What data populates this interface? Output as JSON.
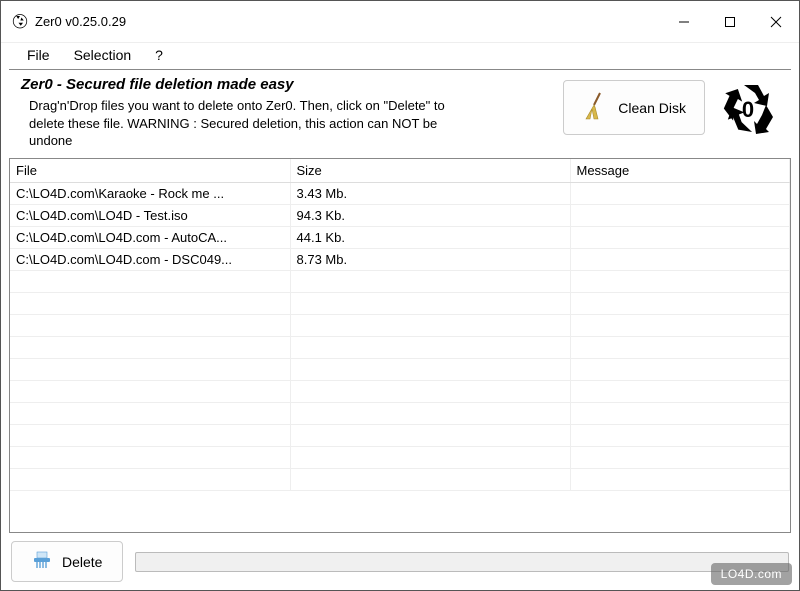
{
  "window": {
    "title": "Zer0 v0.25.0.29"
  },
  "menu": {
    "file": "File",
    "selection": "Selection",
    "help": "?"
  },
  "header": {
    "title": "Zer0 - Secured file deletion made easy",
    "description": "Drag'n'Drop files you want to delete onto Zer0. Then, click on \"Delete\" to delete these file. WARNING : Secured deletion, this action can NOT be undone"
  },
  "buttons": {
    "clean_disk": "Clean Disk",
    "delete": "Delete"
  },
  "table": {
    "cols": {
      "file": "File",
      "size": "Size",
      "message": "Message"
    },
    "rows": [
      {
        "file": "C:\\LO4D.com\\Karaoke - Rock me ...",
        "size": "3.43 Mb.",
        "message": ""
      },
      {
        "file": "C:\\LO4D.com\\LO4D - Test.iso",
        "size": "94.3 Kb.",
        "message": ""
      },
      {
        "file": "C:\\LO4D.com\\LO4D.com - AutoCA...",
        "size": "44.1 Kb.",
        "message": ""
      },
      {
        "file": "C:\\LO4D.com\\LO4D.com - DSC049...",
        "size": "8.73 Mb.",
        "message": ""
      }
    ]
  },
  "watermark": "LO4D.com",
  "logo_text": "0"
}
